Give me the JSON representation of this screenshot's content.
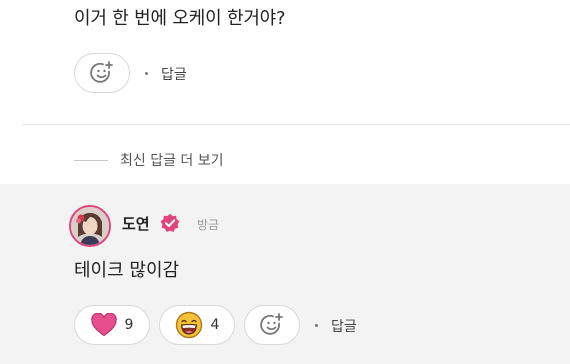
{
  "comment": {
    "text": "이거 한 번에 오케이 한거야?",
    "reply_label": "답글"
  },
  "more_replies": {
    "label": "최신 답글 더 보기"
  },
  "reply": {
    "author": "도연",
    "time": "방금",
    "text": "테이크 많이감",
    "reactions": [
      {
        "icon": "heart-icon",
        "count": "9",
        "color": "#e0457b"
      },
      {
        "icon": "laughing-face-icon",
        "count": "4",
        "color": "#f5b21a"
      }
    ],
    "reply_label": "답글"
  },
  "colors": {
    "accent": "#e0457b",
    "reply_background": "#f3f3f3"
  }
}
